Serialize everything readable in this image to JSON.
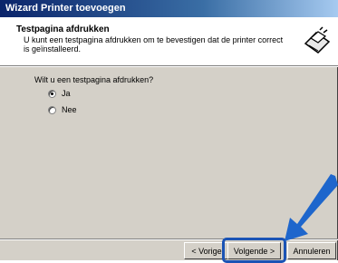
{
  "window": {
    "title": "Wizard Printer toevoegen"
  },
  "header": {
    "title": "Testpagina afdrukken",
    "description": "U kunt een testpagina afdrukken om te bevestigen dat de printer correct is geïnstalleerd.",
    "icon": "printer-check-icon"
  },
  "body": {
    "question": "Wilt u een testpagina afdrukken?",
    "options": [
      {
        "label": "Ja",
        "selected": true
      },
      {
        "label": "Nee",
        "selected": false
      }
    ]
  },
  "buttons": {
    "back": "< Vorige",
    "next": "Volgende >",
    "cancel": "Annuleren"
  },
  "annotation": {
    "icon": "pointer-arrow-icon",
    "highlight_color": "#1a53b5",
    "arrow_color": "#1e66cc"
  }
}
